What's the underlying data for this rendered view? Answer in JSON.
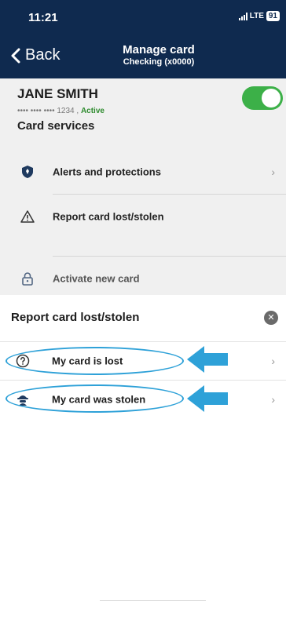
{
  "status_bar": {
    "time": "11:21",
    "network": "LTE",
    "battery": "91"
  },
  "nav": {
    "back_label": "Back",
    "title": "Manage card",
    "subtitle": "Checking (x0000)"
  },
  "card": {
    "holder_name": "JANE SMITH",
    "masked_number": "•••• •••• •••• 1234 ,",
    "status": "Active",
    "toggle_on": true
  },
  "card_services": {
    "title": "Card services",
    "items": [
      {
        "label": "Alerts and protections",
        "icon": "shield-icon",
        "has_chevron": true
      },
      {
        "label": "Report card lost/stolen",
        "icon": "warning-icon",
        "has_chevron": false
      },
      {
        "label": "Activate new card",
        "icon": "lock-icon",
        "has_chevron": false
      }
    ]
  },
  "sheet": {
    "title": "Report card lost/stolen",
    "options": [
      {
        "label": "My card is lost",
        "icon": "question-circle-icon"
      },
      {
        "label": "My card was stolen",
        "icon": "thief-icon"
      }
    ]
  },
  "annotation_color": "#2ea1d8",
  "accent_color": "#3cb048",
  "header_color": "#0f2a4f"
}
